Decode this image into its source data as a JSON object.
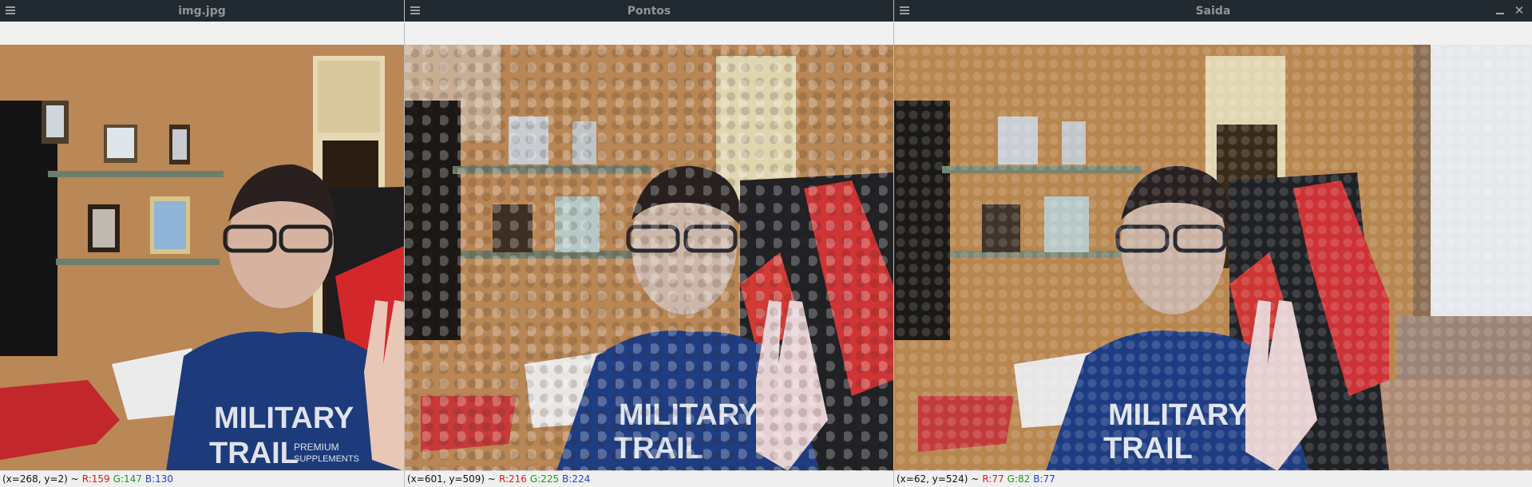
{
  "windows": [
    {
      "title": "img.jpg",
      "status": {
        "coords": "(x=268, y=2) ~",
        "r": "R:159",
        "g": "G:147",
        "b": "B:130"
      },
      "shirt": {
        "line1": "MILITARY",
        "line2": "TRAIL",
        "tag1": "PREMIUM",
        "tag2": "SUPPLEMENTS"
      }
    },
    {
      "title": "Pontos",
      "status": {
        "coords": "(x=601, y=509) ~",
        "r": "R:216",
        "g": "G:225",
        "b": "B:224"
      },
      "shirt": {
        "line1": "MILITARY",
        "line2": "TRAIL",
        "tag1": "",
        "tag2": ""
      }
    },
    {
      "title": "Saida",
      "status": {
        "coords": "(x=62, y=524) ~",
        "r": "R:77",
        "g": "G:82",
        "b": "B:77"
      },
      "shirt": {
        "line1": "MILITARY",
        "line2": "TRAIL",
        "tag1": "",
        "tag2": ""
      }
    }
  ],
  "icons": {
    "menu": "hamburger-menu-icon",
    "minimize": "minimize-icon",
    "close": "close-icon"
  },
  "close_glyph": "✕",
  "colors": {
    "titlebar": "#222a31",
    "wall": "#b98656",
    "shirt": "#1d3b7a",
    "chair_red": "#d3272b"
  }
}
